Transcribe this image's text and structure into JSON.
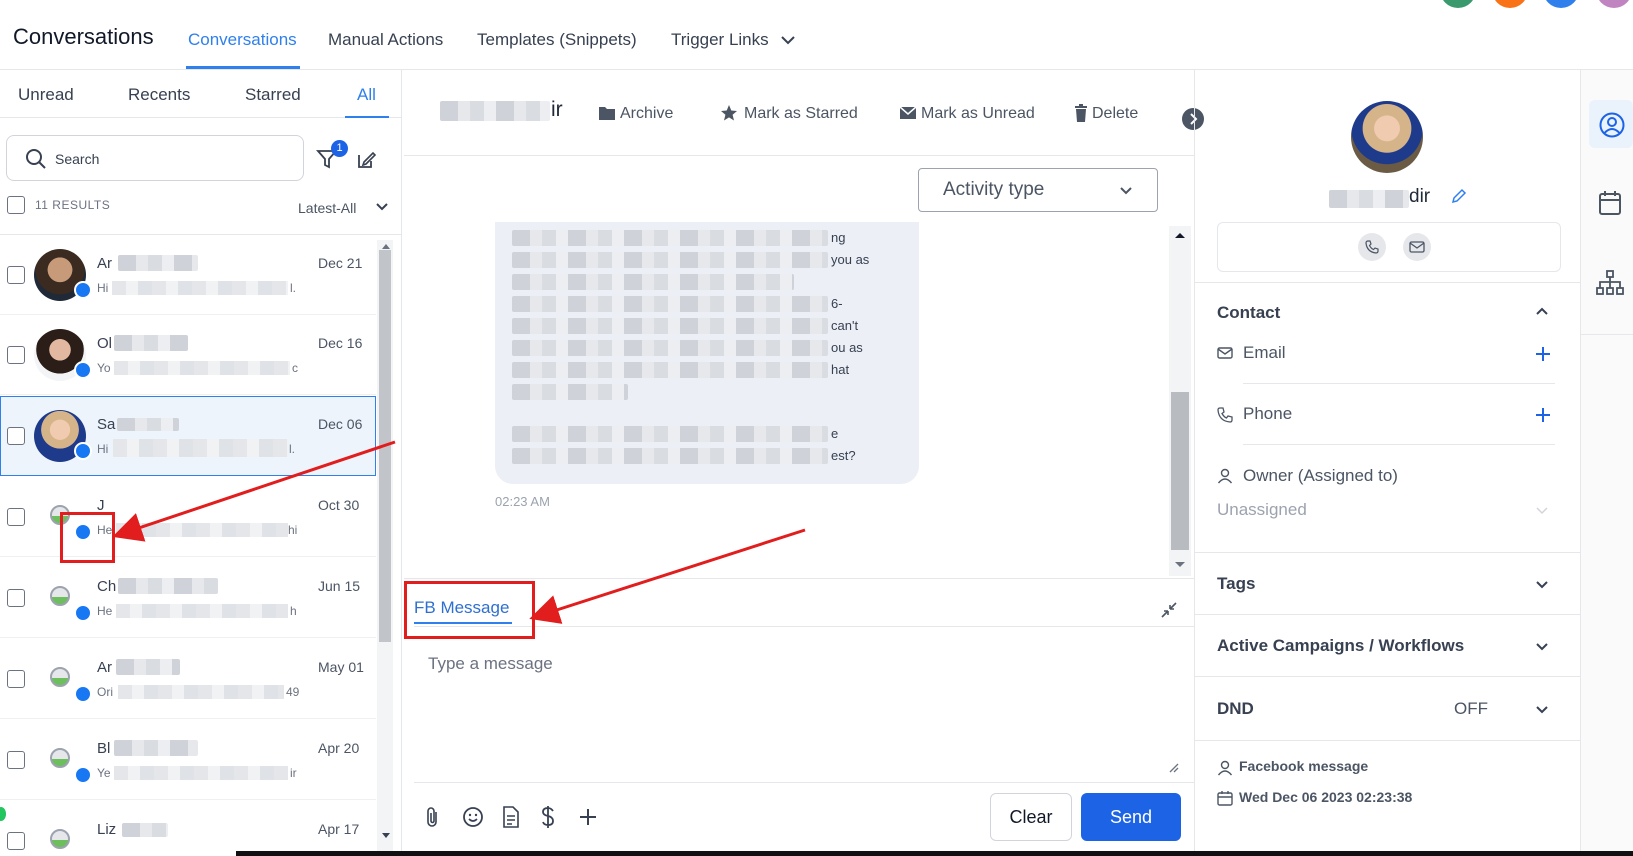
{
  "app": {
    "title": "Conversations"
  },
  "top_nav": {
    "tabs": [
      "Conversations",
      "Manual Actions",
      "Templates (Snippets)",
      "Trigger Links"
    ],
    "active_index": 0
  },
  "left": {
    "tabs": [
      "Unread",
      "Recents",
      "Starred",
      "All"
    ],
    "active_tab": "All",
    "search_placeholder": "Search",
    "filter_badge": "1",
    "results_count": "11 RESULTS",
    "sort_label": "Latest-All",
    "conversations": [
      {
        "name": "Ar",
        "snippet_start": "Hi",
        "snippet_end": "l.",
        "date": "Dec 21"
      },
      {
        "name": "Ol",
        "snippet_start": "Yo",
        "snippet_end": "c",
        "date": "Dec 16"
      },
      {
        "name": "Sa",
        "snippet_start": "Hi",
        "snippet_end": "l.",
        "date": "Dec 06"
      },
      {
        "name": "J",
        "snippet_start": "He",
        "snippet_end": "hi",
        "date": "Oct 30"
      },
      {
        "name": "Ch",
        "snippet_start": "He",
        "snippet_end": "h",
        "date": "Jun 15"
      },
      {
        "name": "Ar",
        "snippet_start": "Ori",
        "snippet_end": "49",
        "date": "May 01"
      },
      {
        "name": "Bl",
        "snippet_start": "Ye",
        "snippet_end": "ir",
        "date": "Apr 20"
      },
      {
        "name": "Liz",
        "snippet_start": "",
        "snippet_end": "",
        "date": "Apr 17"
      }
    ]
  },
  "chat": {
    "contact_name_suffix": "ir",
    "actions": [
      "Archive",
      "Mark as Starred",
      "Mark as Unread",
      "Delete"
    ],
    "activity_type_label": "Activity type",
    "message_fragments": [
      "ng",
      "you as",
      "6-",
      "can't",
      "ou as",
      "hat",
      "e",
      "est?"
    ],
    "message_time": "02:23 AM",
    "compose_tab": "FB Message",
    "compose_placeholder": "Type a message",
    "clear_label": "Clear",
    "send_label": "Send"
  },
  "contact": {
    "name_suffix": "dir",
    "contact_section": "Contact",
    "email_label": "Email",
    "phone_label": "Phone",
    "owner_label": "Owner (Assigned to)",
    "owner_value": "Unassigned",
    "tags_label": "Tags",
    "campaigns_label": "Active Campaigns / Workflows",
    "dnd_label": "DND",
    "dnd_value": "OFF",
    "source_label": "Facebook message",
    "created_label": "Wed Dec 06 2023 02:23:38"
  },
  "colors": {
    "accent": "#2f80ed",
    "send": "#1d63e6",
    "messenger": "#1877f2",
    "annotation": "#e11d1d"
  }
}
